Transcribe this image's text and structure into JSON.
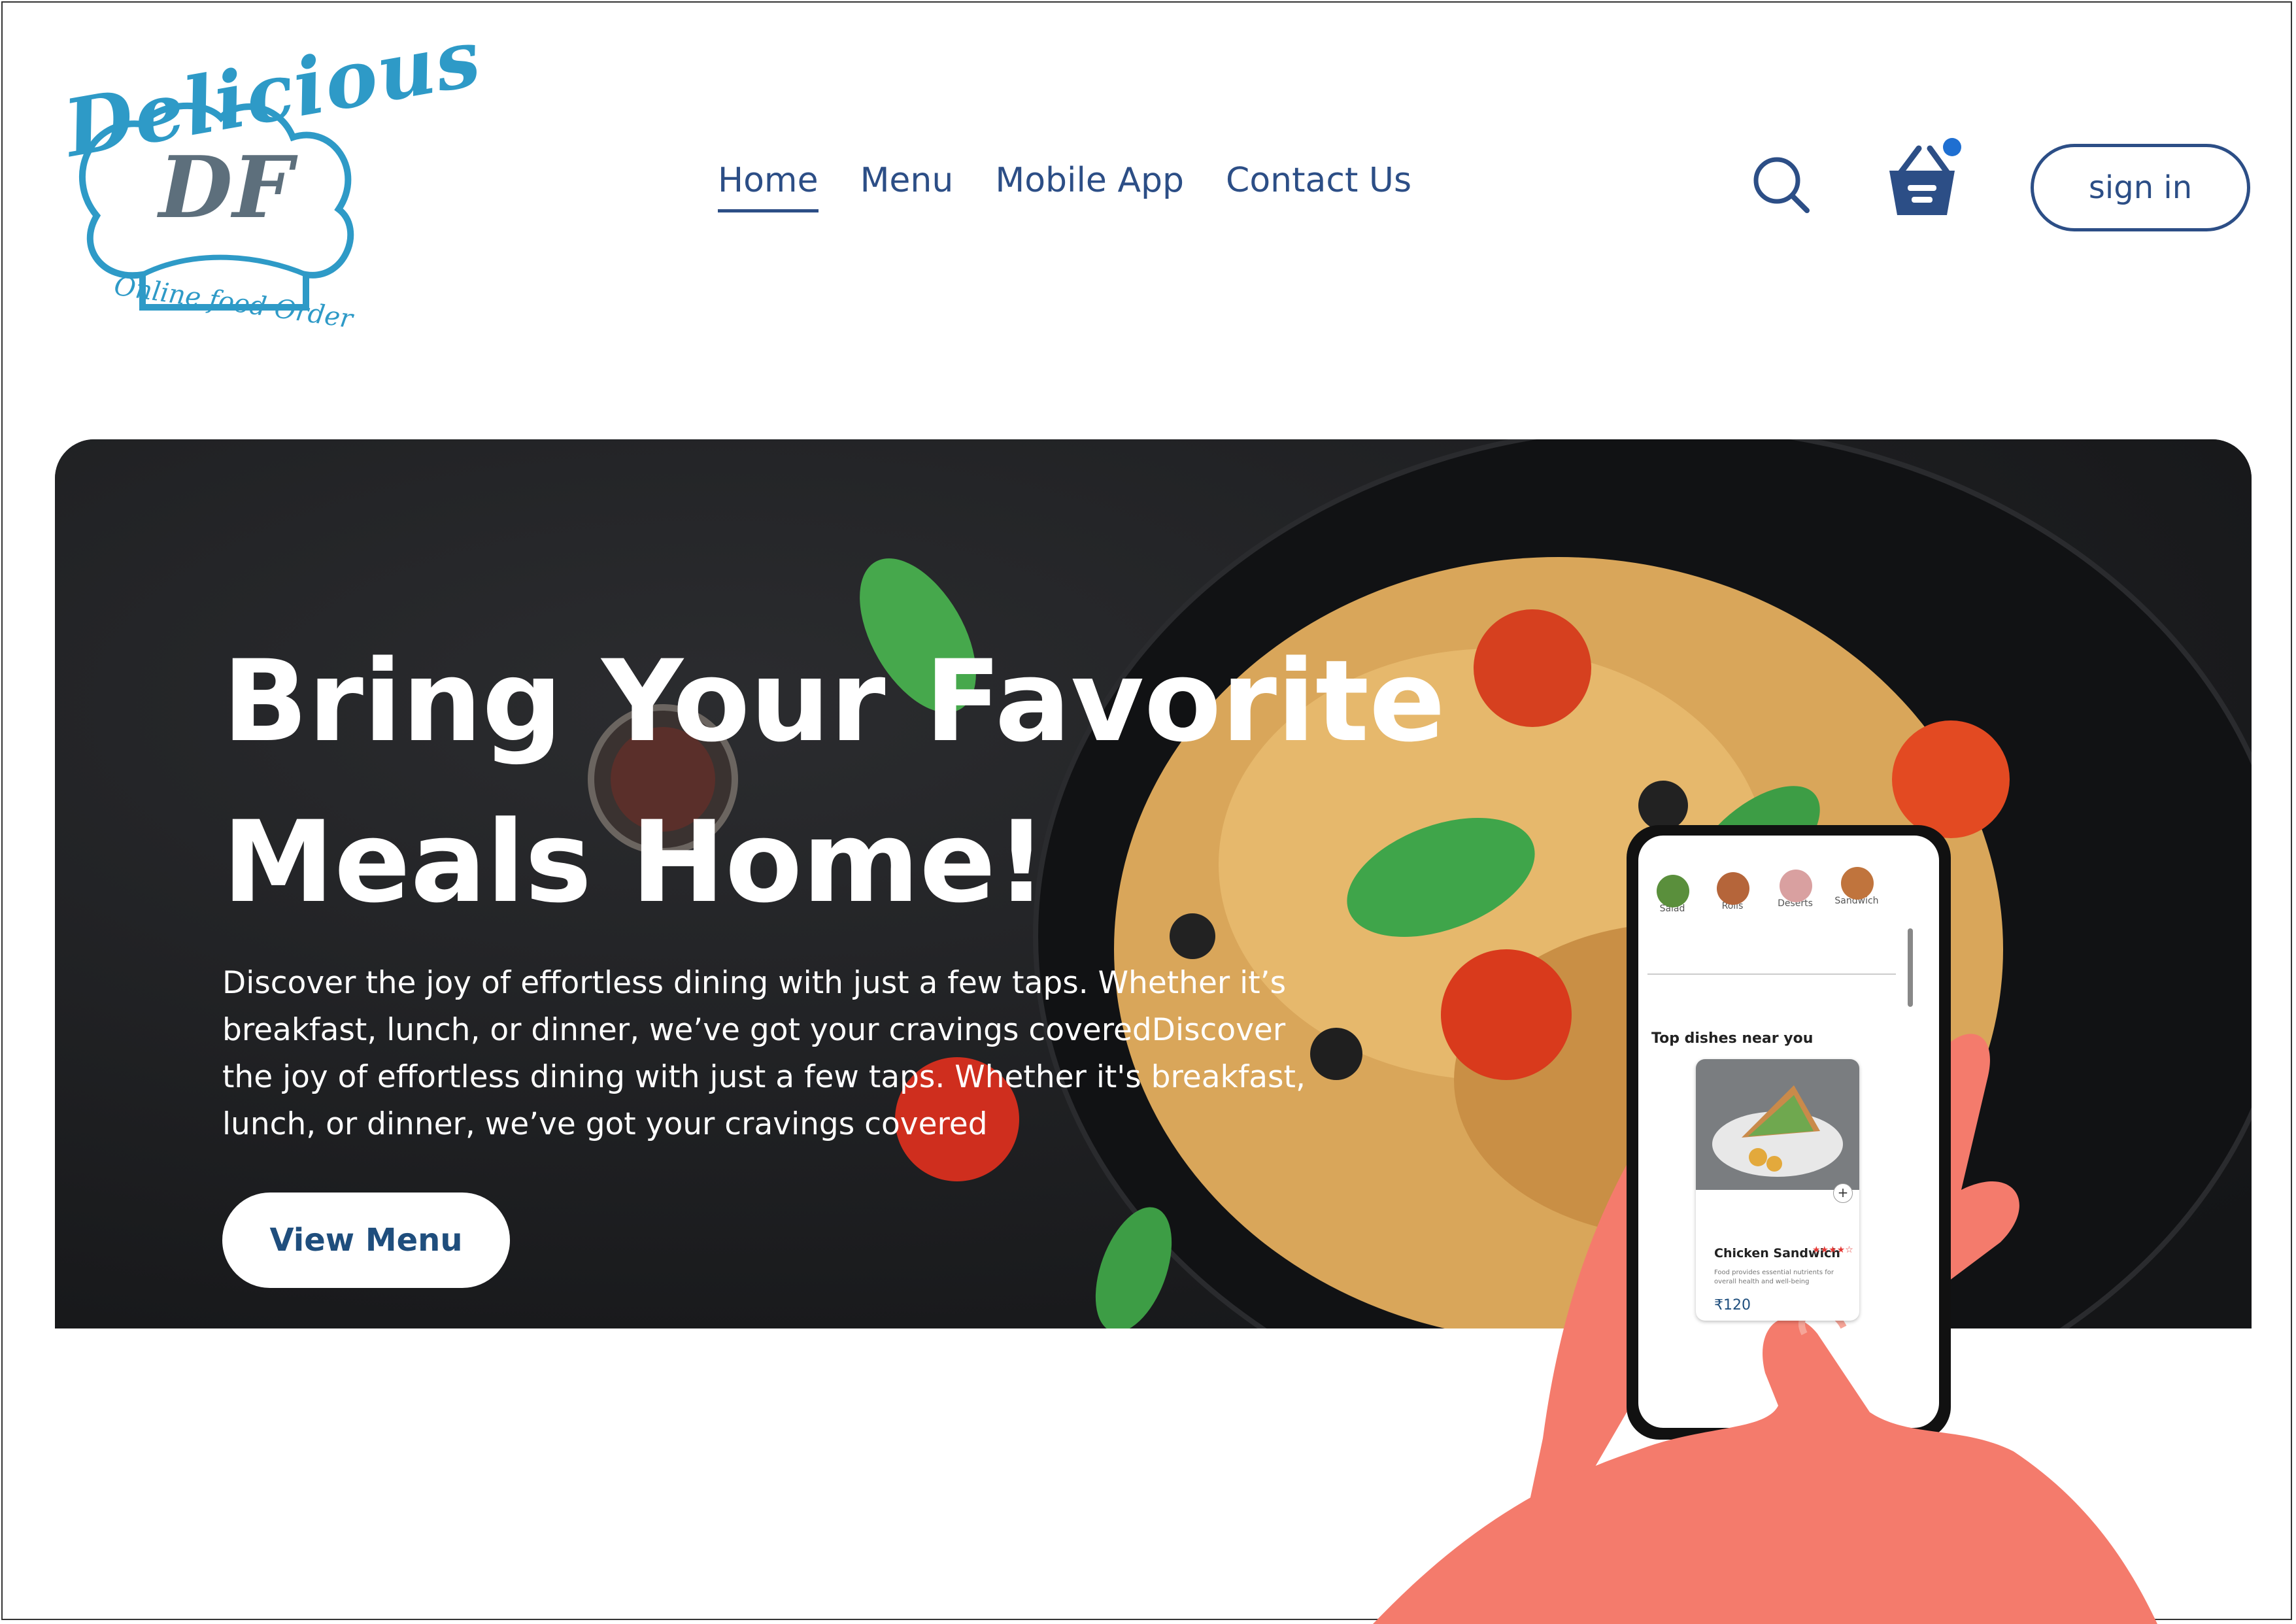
{
  "logo": {
    "title": "Delicious",
    "monogram": "DF",
    "tagline": "Online food Order"
  },
  "nav": {
    "items": [
      {
        "label": "Home",
        "active": true
      },
      {
        "label": "Menu",
        "active": false
      },
      {
        "label": "Mobile App",
        "active": false
      },
      {
        "label": "Contact Us",
        "active": false
      }
    ],
    "search_icon": "search-icon",
    "basket_icon": "basket-icon",
    "signin_label": "sign in"
  },
  "hero": {
    "headline_line1": "Bring Your Favorite",
    "headline_line2": "Meals Home!",
    "description": "Discover the joy of effortless dining with just a few taps. Whether it’s breakfast, lunch, or dinner, we’ve got your cravings coveredDiscover the joy of effortless dining with just a few taps. Whether it's breakfast, lunch, or dinner, we’ve got your cravings covered",
    "cta_label": "View Menu"
  },
  "phone": {
    "categories": [
      "Salad",
      "Rolls",
      "Deserts",
      "Sandwich"
    ],
    "section_title": "Top dishes near you",
    "dish": {
      "name": "Chicken Sandwich",
      "rating": "★★★★☆",
      "description": "Food provides essential nutrients for overall health and well-being",
      "price": "₹120"
    }
  },
  "colors": {
    "brand_blue": "#2c4e86",
    "logo_blue": "#2e9ac7",
    "cart_dot": "#1f6fd1",
    "hand": "#f47b6c"
  }
}
